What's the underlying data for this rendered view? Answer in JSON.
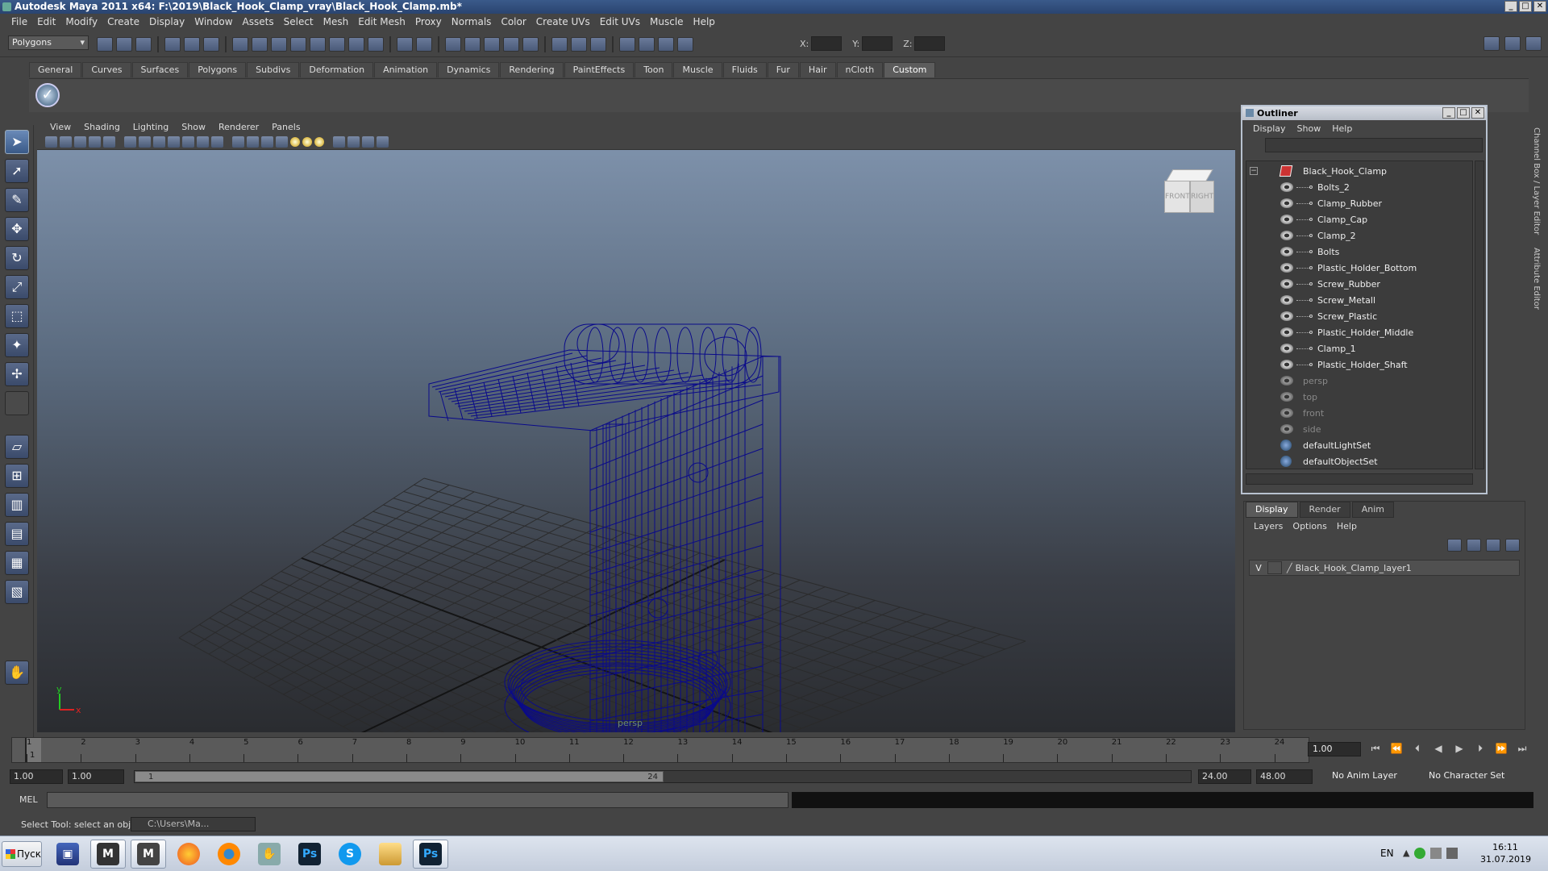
{
  "window": {
    "title": "Autodesk Maya 2011 x64: F:\\2019\\Black_Hook_Clamp_vray\\Black_Hook_Clamp.mb*"
  },
  "menubar": [
    "File",
    "Edit",
    "Modify",
    "Create",
    "Display",
    "Window",
    "Assets",
    "Select",
    "Mesh",
    "Edit Mesh",
    "Proxy",
    "Normals",
    "Color",
    "Create UVs",
    "Edit UVs",
    "Muscle",
    "Help"
  ],
  "status": {
    "mode": "Polygons",
    "x_label": "X:",
    "y_label": "Y:",
    "z_label": "Z:"
  },
  "shelf_tabs": [
    "General",
    "Curves",
    "Surfaces",
    "Polygons",
    "Subdivs",
    "Deformation",
    "Animation",
    "Dynamics",
    "Rendering",
    "PaintEffects",
    "Toon",
    "Muscle",
    "Fluids",
    "Fur",
    "Hair",
    "nCloth",
    "Custom"
  ],
  "shelf_active": "Custom",
  "viewport": {
    "menu": [
      "View",
      "Shading",
      "Lighting",
      "Show",
      "Renderer",
      "Panels"
    ],
    "camera": "persp",
    "viewcube": {
      "front": "FRONT",
      "right": "RIGHT"
    },
    "wire_color": "#0a0a8a"
  },
  "outliner": {
    "title": "Outliner",
    "menu": [
      "Display",
      "Show",
      "Help"
    ],
    "root": "Black_Hook_Clamp",
    "children": [
      "Bolts_2",
      "Clamp_Rubber",
      "Clamp_Cap",
      "Clamp_2",
      "Bolts",
      "Plastic_Holder_Bottom",
      "Screw_Rubber",
      "Screw_Metall",
      "Screw_Plastic",
      "Plastic_Holder_Middle",
      "Clamp_1",
      "Plastic_Holder_Shaft"
    ],
    "cameras": [
      "persp",
      "top",
      "front",
      "side"
    ],
    "sets": [
      "defaultLightSet",
      "defaultObjectSet"
    ]
  },
  "right_strip": "Channel Box / Layer Editor",
  "right_strip2": "Attribute Editor",
  "layers": {
    "tabs": [
      "Display",
      "Render",
      "Anim"
    ],
    "menu": [
      "Layers",
      "Options",
      "Help"
    ],
    "row": {
      "visible": "V",
      "name": "Black_Hook_Clamp_layer1"
    }
  },
  "timeline": {
    "ticks": [
      "1",
      "2",
      "3",
      "4",
      "5",
      "6",
      "7",
      "8",
      "9",
      "10",
      "11",
      "12",
      "13",
      "14",
      "15",
      "16",
      "17",
      "18",
      "19",
      "20",
      "21",
      "22",
      "23",
      "24"
    ],
    "current": "1.00",
    "cursor_label": "1"
  },
  "range": {
    "start": "1.00",
    "start2": "1.00",
    "slider_start": "1",
    "slider_end": "24",
    "end": "24.00",
    "end2": "48.00",
    "anim_layer": "No Anim Layer",
    "char_set": "No Character Set"
  },
  "mel": {
    "label": "MEL"
  },
  "help": {
    "text": "Select Tool: select an object",
    "minimized": "C:\\Users\\Ma..."
  },
  "taskbar": {
    "start": "Пуск",
    "lang": "EN",
    "time": "16:11",
    "date": "31.07.2019"
  }
}
